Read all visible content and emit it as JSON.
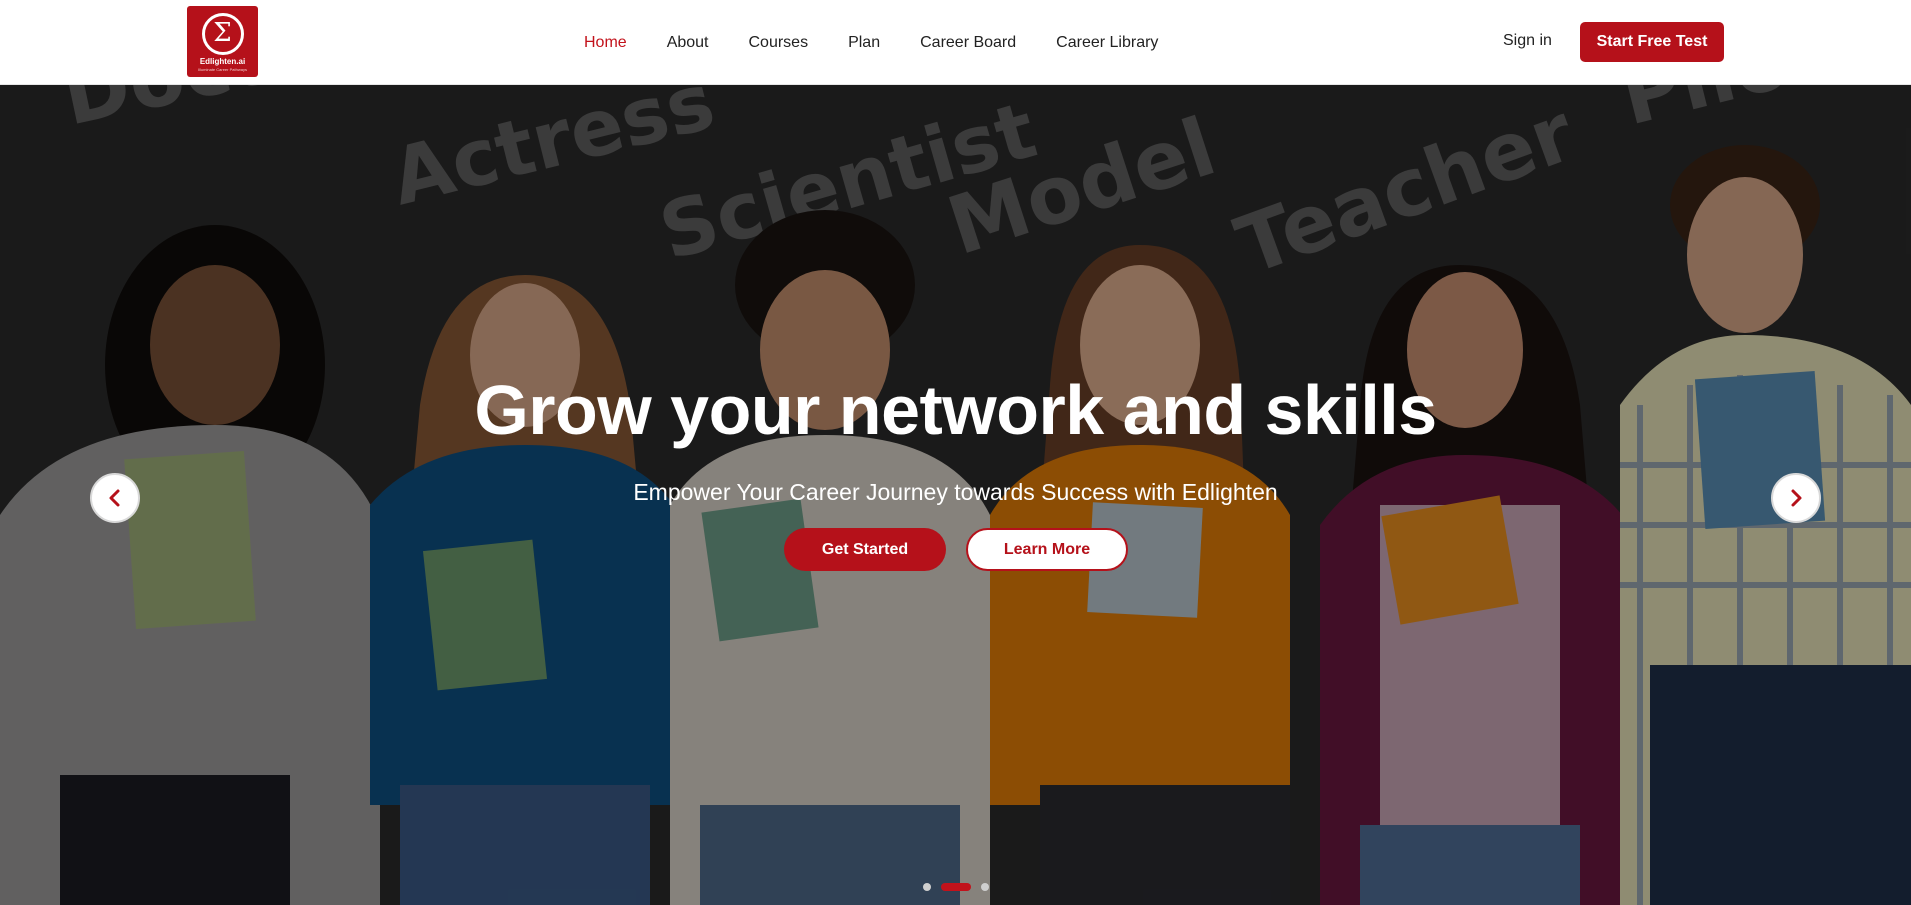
{
  "brand": {
    "name": "Edlighten.ai",
    "tagline": "Illuminate Career Pathways",
    "color": "#b5111a"
  },
  "nav": {
    "items": [
      {
        "label": "Home",
        "active": true
      },
      {
        "label": "About",
        "active": false
      },
      {
        "label": "Courses",
        "active": false
      },
      {
        "label": "Plan",
        "active": false
      },
      {
        "label": "Career Board",
        "active": false
      },
      {
        "label": "Career Library",
        "active": false
      }
    ],
    "sign_in_label": "Sign in",
    "cta_label": "Start Free Test"
  },
  "hero": {
    "title": "Grow your network and skills",
    "subtitle": "Empower Your Career Journey towards Success with Edlighten",
    "primary_button": "Get Started",
    "secondary_button": "Learn More",
    "background_words": [
      "Doctor",
      "Actress",
      "Scientist",
      "Model",
      "Teacher",
      "Pilot"
    ],
    "prev_icon": "chevron-left-icon",
    "next_icon": "chevron-right-icon"
  },
  "carousel": {
    "slide_count": 3,
    "active_index": 1
  }
}
